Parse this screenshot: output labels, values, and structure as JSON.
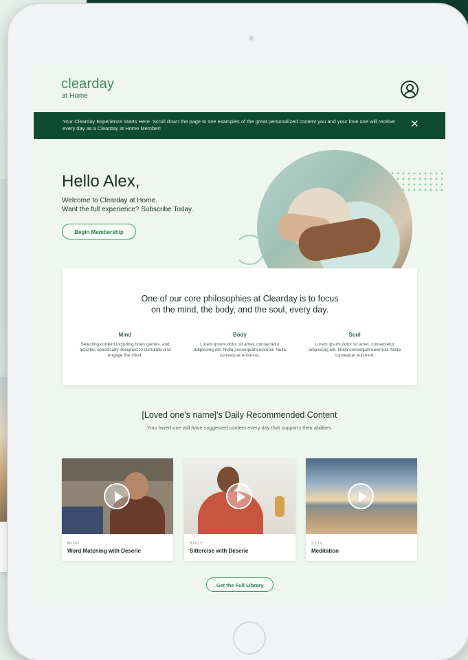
{
  "header": {
    "logo": "clearday",
    "logo_sub": "at Home"
  },
  "banner": {
    "text": "Your Clearday Experience Starts Here. Scroll down the page to see examples of the great personalized content you and your love one will receive every day as a Clearday at Home Member!",
    "close": "✕"
  },
  "hero": {
    "greeting": "Hello Alex,",
    "line1": "Welcome to Clearday at Home.",
    "line2": "Want the full experience? Subscribe Today.",
    "cta": "Begin Membership"
  },
  "philosophy": {
    "title_line1": "One of our core philosophies at Clearday is to focus",
    "title_line2": "on the mind, the body, and the soul, every day.",
    "columns": [
      {
        "heading": "Mind",
        "text": "Selecting content including brain games, and activites specifically designed to stimulate and engage the mind."
      },
      {
        "heading": "Body",
        "text": "Lorem ipsum dolor sit amet, consectetur adipiscing elit. Nulla consequat euismod. Nulla consequat euismod."
      },
      {
        "heading": "Soul",
        "text": "Lorem ipsum dolor sit amet, consectetur adipiscing elit. Nulla consequat euismod. Nulla consequat euismod."
      }
    ]
  },
  "daily": {
    "title": "[Loved one's name]'s Daily Recommended Content",
    "subtitle": "Your loved one will have suggested content every day that supports their abilities.",
    "cards": [
      {
        "category": "MIND",
        "name": "Word Matching with Deserie"
      },
      {
        "category": "BODY",
        "name": "Sittercise with Deserie"
      },
      {
        "category": "SOUL",
        "name": "Meditation"
      }
    ],
    "cta": "Get the Full Library"
  }
}
